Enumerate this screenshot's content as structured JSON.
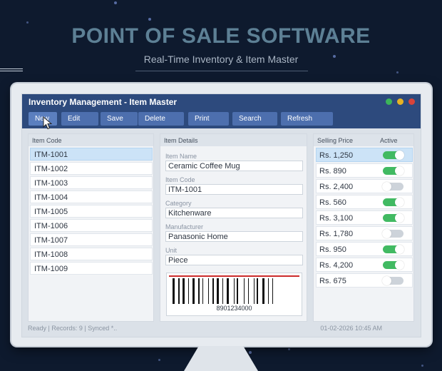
{
  "hero": {
    "title": "POINT OF SALE SOFTWARE",
    "subtitle": "Real-Time Inventory & Item Master"
  },
  "window": {
    "title": "Inventory Management  -  Item Master"
  },
  "toolbar": [
    {
      "label": "New",
      "name": "new-button",
      "active": true
    },
    {
      "label": "Edit",
      "name": "edit-button"
    },
    {
      "label": "Save",
      "name": "save-button"
    },
    {
      "label": "Delete",
      "name": "delete-button"
    },
    {
      "label": "Print",
      "name": "print-button"
    },
    {
      "label": "Search",
      "name": "search-button"
    },
    {
      "label": "Refresh",
      "name": "refresh-button"
    }
  ],
  "codes_panel": {
    "header": "Item Code",
    "items": [
      "ITM-1001",
      "ITM-1002",
      "ITM-1003",
      "ITM-1004",
      "ITM-1005",
      "ITM-1006",
      "ITM-1007",
      "ITM-1008",
      "ITM-1009"
    ],
    "selected_index": 0
  },
  "details_panel": {
    "header": "Item Details",
    "fields": [
      {
        "label": "Item Name",
        "value": "Ceramic Coffee Mug"
      },
      {
        "label": "Item Code",
        "value": "ITM-1001"
      },
      {
        "label": "Category",
        "value": "Kitchenware"
      },
      {
        "label": "Manufacturer",
        "value": "Panasonic Home"
      },
      {
        "label": "Unit",
        "value": "Piece"
      }
    ],
    "barcode": "8901234000"
  },
  "prices_panel": {
    "header_price": "Selling Price",
    "header_active": "Active",
    "rows": [
      {
        "price": "Rs. 1,250",
        "active": true
      },
      {
        "price": "Rs. 890",
        "active": true
      },
      {
        "price": "Rs. 2,400",
        "active": false
      },
      {
        "price": "Rs. 560",
        "active": true
      },
      {
        "price": "Rs. 3,100",
        "active": true
      },
      {
        "price": "Rs. 1,780",
        "active": false
      },
      {
        "price": "Rs. 950",
        "active": true
      },
      {
        "price": "Rs. 4,200",
        "active": true
      },
      {
        "price": "Rs. 675",
        "active": false
      }
    ],
    "selected_index": 0
  },
  "status": {
    "left": "Ready  |  Records: 9  |  Synced *..",
    "right": "01-02-2026 10:45 AM"
  },
  "colors": {
    "background": "#0e1a2e",
    "accent": "#2d4a7d",
    "toggle_on": "#41ba62",
    "selection": "#cce3f7"
  }
}
